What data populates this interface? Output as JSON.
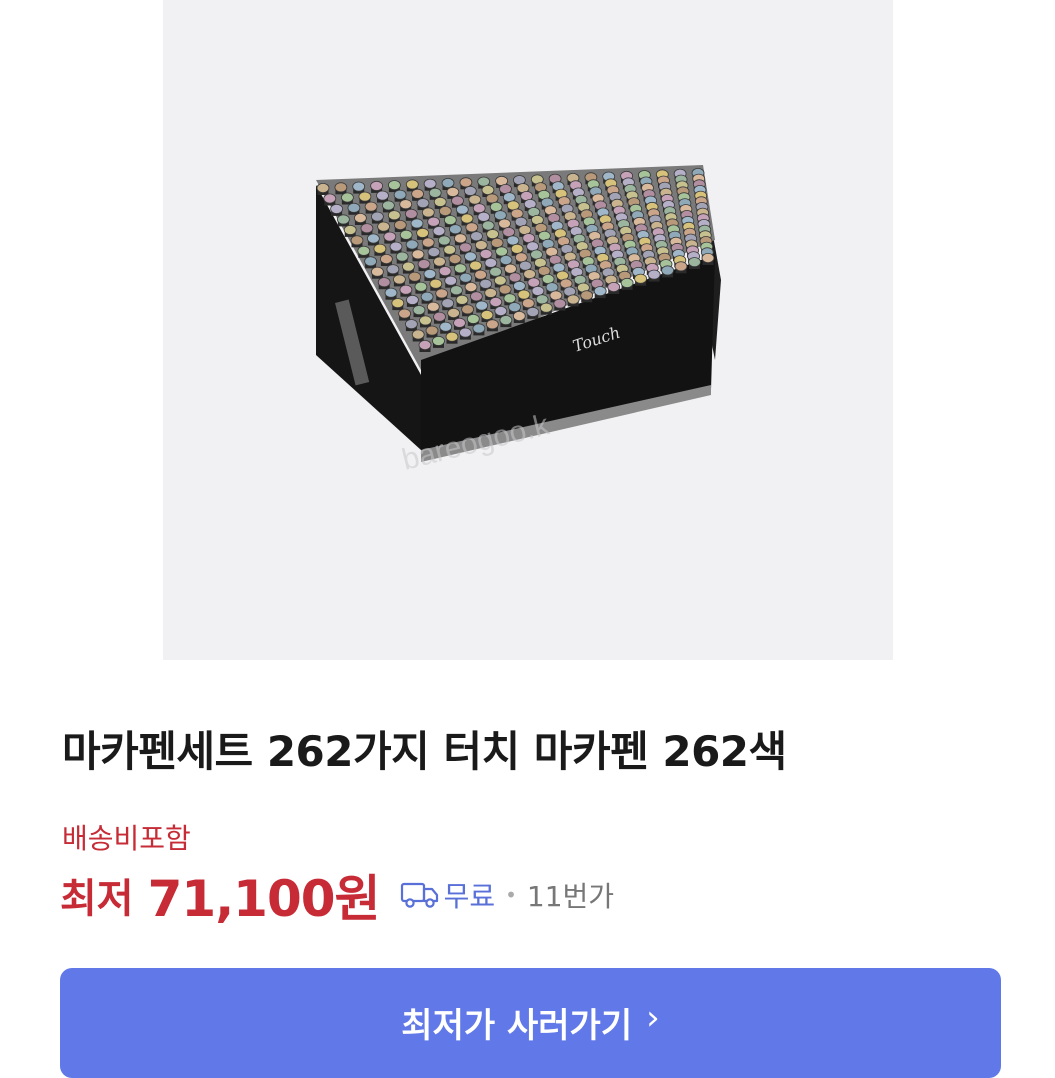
{
  "product": {
    "image_alt": "마카펜세트 262가지 터치 마카펜 262색",
    "brand_mark": "Touch",
    "title": "마카펜세트 262가지 터치 마카펜 262색"
  },
  "pricing": {
    "shipping_note": "배송비포함",
    "prefix": "최저",
    "price": "71,100원",
    "shipping": "무료",
    "separator": "•",
    "seller": "11번가"
  },
  "cta": {
    "label": "최저가 사러가기",
    "chevron": "›"
  },
  "colors": {
    "accent": "#6178e8",
    "price": "#c62b36",
    "shipping": "#5870d8"
  },
  "icons": {
    "expand": "expand-icon",
    "truck": "truck-icon"
  }
}
